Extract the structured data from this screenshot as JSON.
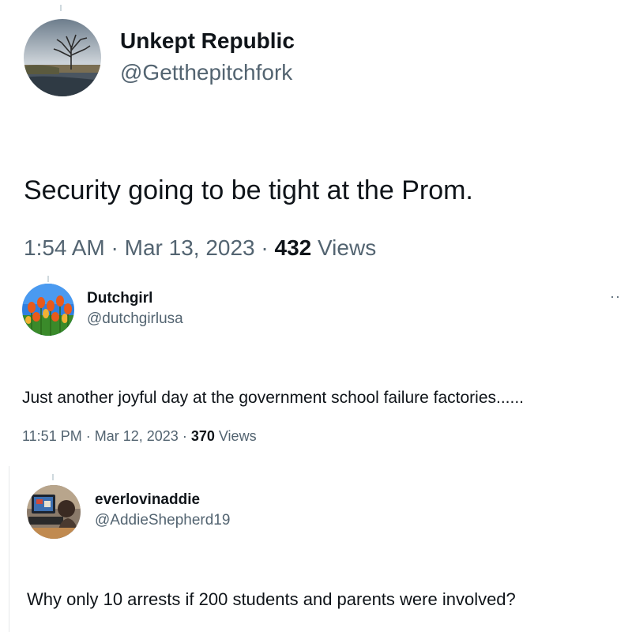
{
  "tweets": [
    {
      "name": "Unkept Republic",
      "handle": "@Getthepitchfork",
      "text": "Security going to be tight at the Prom.",
      "time": "1:54 AM",
      "date": "Mar 13, 2023",
      "views_count": "432",
      "views_label": "Views"
    },
    {
      "name": "Dutchgirl",
      "handle": "@dutchgirlusa",
      "more": "··",
      "text": "Just another joyful day at the government school failure factories......",
      "time": "11:51 PM",
      "date": "Mar 12, 2023",
      "views_count": "370",
      "views_label": "Views"
    },
    {
      "name": "everlovinaddie",
      "handle": "@AddieShepherd19",
      "text": "Why only 10 arrests if 200 students and parents were involved?"
    }
  ],
  "separator": "·",
  "icons": {
    "avatar_1": "tree-landscape-avatar",
    "avatar_2": "tulips-avatar",
    "avatar_3": "person-at-computer-avatar",
    "more": "more-options-icon"
  }
}
